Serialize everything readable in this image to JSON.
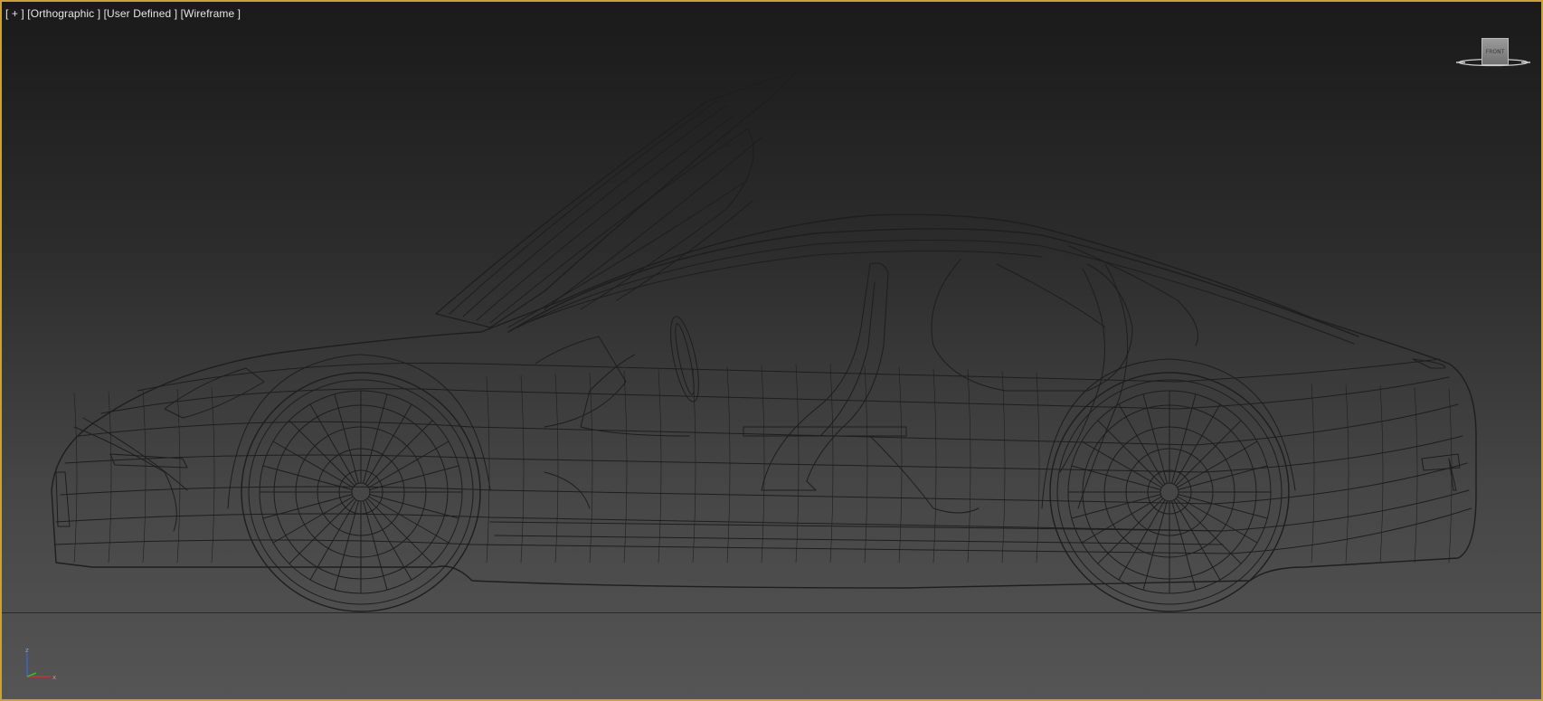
{
  "viewport": {
    "label_plus": "[ + ]",
    "label_projection": "[Orthographic ]",
    "label_view": "[User Defined ]",
    "label_shading": "[Wireframe ]"
  },
  "viewcube": {
    "face_label": "FRONT",
    "icon": "viewcube-icon"
  },
  "axis": {
    "z_label": "z",
    "x_label": "x",
    "icon": "axis-tripod-icon"
  },
  "colors": {
    "border_active": "#c8a23a",
    "wire": "#1e1e1e",
    "axis_x": "#c83232",
    "axis_y": "#3cb43c",
    "axis_z": "#3c64c8"
  }
}
